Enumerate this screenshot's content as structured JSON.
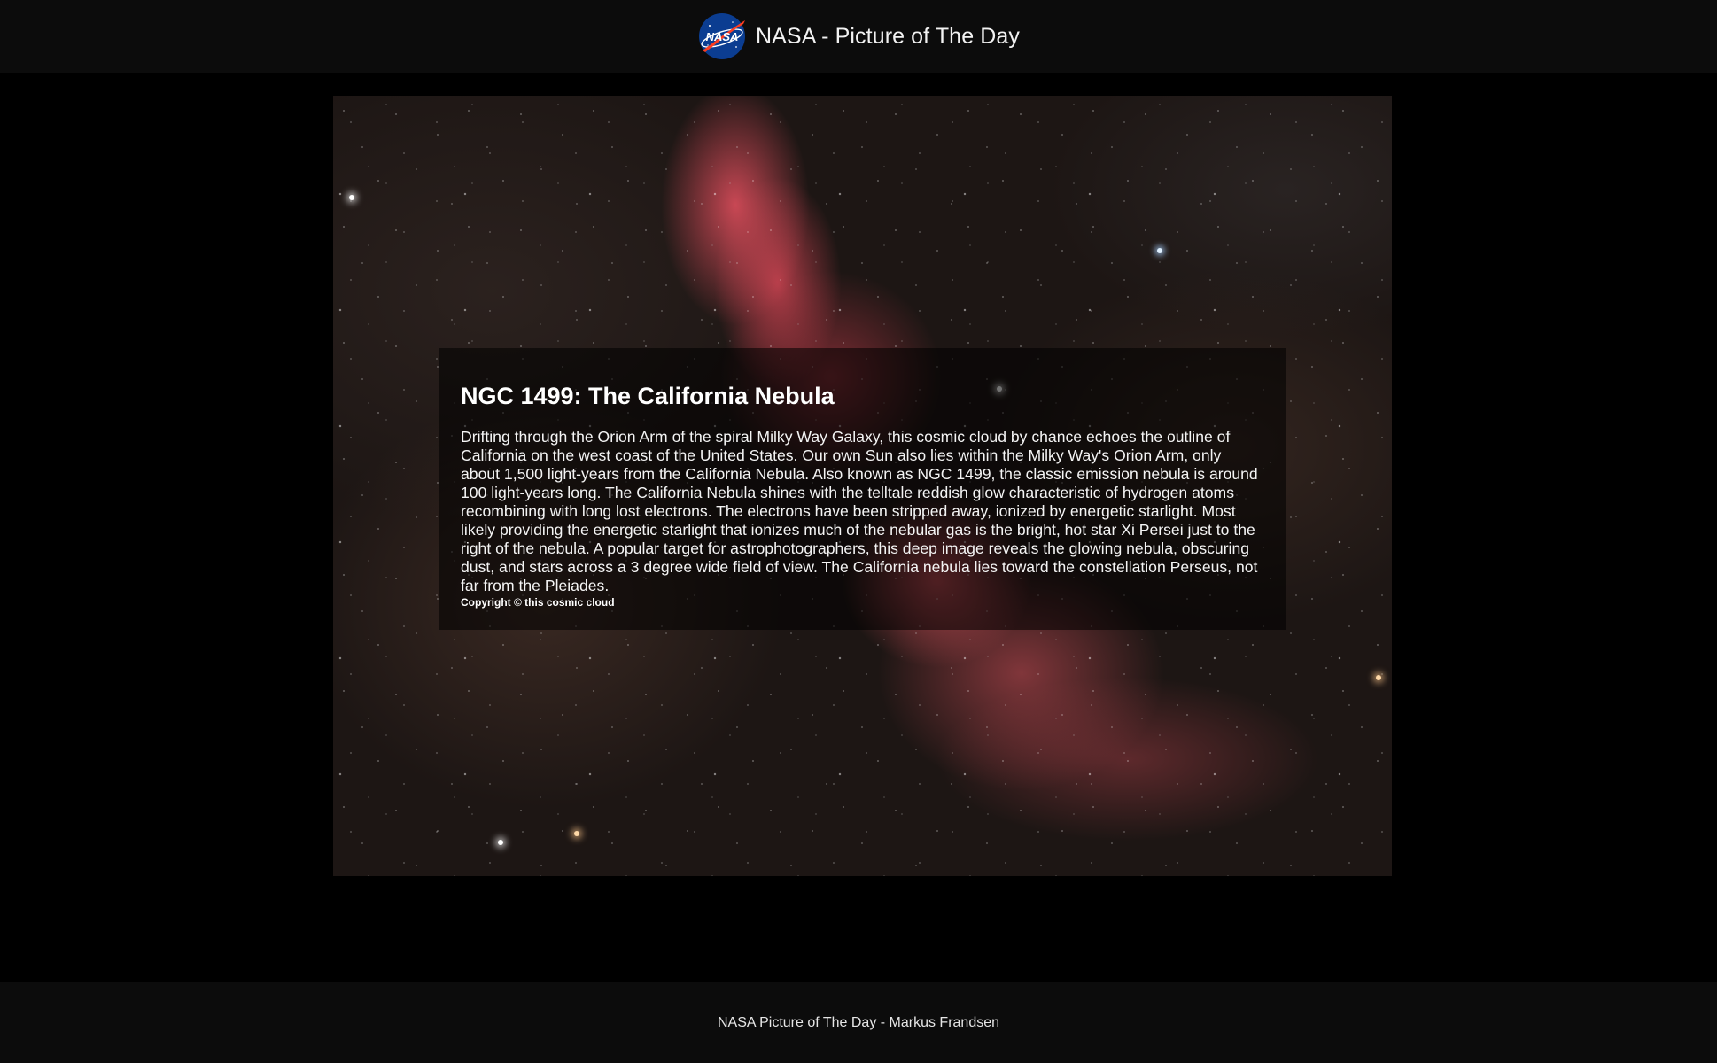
{
  "header": {
    "logo_label": "NASA",
    "title": "NASA - Picture of The Day",
    "logo_icon": "nasa-meatball-icon"
  },
  "apod": {
    "title": "NGC 1499: The California Nebula",
    "explanation": "Drifting through the Orion Arm of the spiral Milky Way Galaxy, this cosmic cloud by chance echoes the outline of California on the west coast of the United States. Our own Sun also lies within the Milky Way's Orion Arm, only about 1,500 light-years from the California Nebula. Also known as NGC 1499, the classic emission nebula is around 100 light-years long. The California Nebula shines with the telltale reddish glow characteristic of hydrogen atoms recombining with long lost electrons. The electrons have been stripped away, ionized by energetic starlight. Most likely providing the energetic starlight that ionizes much of the nebular gas is the bright, hot star Xi Persei just to the right of the nebula. A popular target for astrophotographers, this deep image reveals the glowing nebula, obscuring dust, and stars across a 3 degree wide field of view. The California nebula lies toward the constellation Perseus, not far from the Pleiades.",
    "copyright": "Copyright © this cosmic cloud"
  },
  "footer": {
    "text": "NASA Picture of The Day - Markus Frandsen"
  },
  "colors": {
    "header_bg": "#0c0c0c",
    "page_bg": "#000000",
    "nasa_blue": "#0b3d91",
    "nasa_red": "#fc3d21"
  }
}
